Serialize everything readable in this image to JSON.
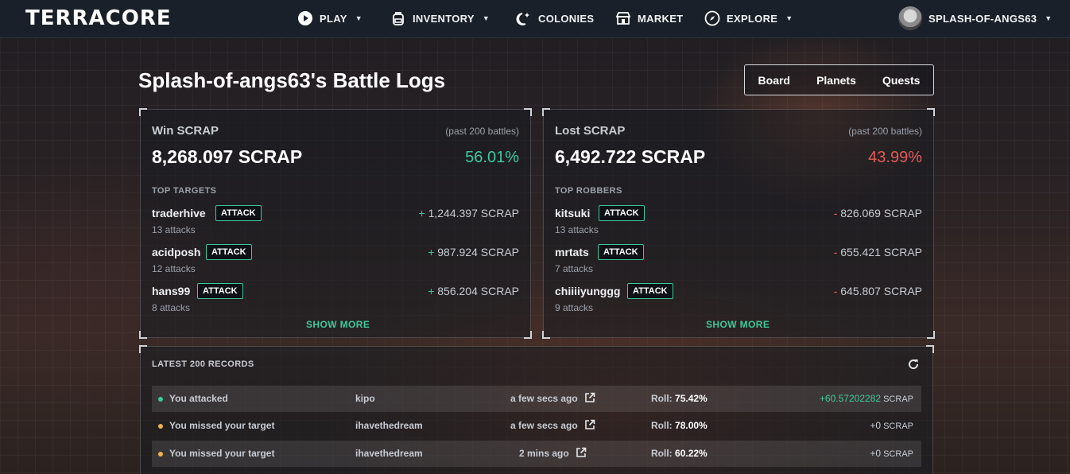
{
  "nav": {
    "logo": "TERRACORE",
    "items": [
      {
        "label": "PLAY",
        "icon": "play-icon",
        "caret": true
      },
      {
        "label": "INVENTORY",
        "icon": "backpack-icon",
        "caret": true
      },
      {
        "label": "COLONIES",
        "icon": "moon-stars-icon",
        "caret": false
      },
      {
        "label": "MARKET",
        "icon": "store-icon",
        "caret": false
      },
      {
        "label": "EXPLORE",
        "icon": "compass-icon",
        "caret": true
      }
    ],
    "user": "SPLASH-OF-ANGS63"
  },
  "page": {
    "title": "Splash-of-angs63's Battle Logs",
    "tabs": [
      "Board",
      "Planets",
      "Quests"
    ]
  },
  "win": {
    "title": "Win SCRAP",
    "sub": "(past 200 battles)",
    "amount": "8,268.097 SCRAP",
    "pct": "56.01%",
    "section": "TOP TARGETS",
    "rows": [
      {
        "name": "traderhive",
        "attacks": "13 attacks",
        "sign": "+",
        "amount": "1,244.397 SCRAP"
      },
      {
        "name": "acidposh",
        "attacks": "12 attacks",
        "sign": "+",
        "amount": "987.924 SCRAP"
      },
      {
        "name": "hans99",
        "attacks": "8 attacks",
        "sign": "+",
        "amount": "856.204 SCRAP"
      }
    ],
    "show_more": "SHOW MORE"
  },
  "lost": {
    "title": "Lost SCRAP",
    "sub": "(past 200 battles)",
    "amount": "6,492.722 SCRAP",
    "pct": "43.99%",
    "section": "TOP ROBBERS",
    "rows": [
      {
        "name": "kitsuki",
        "attacks": "13 attacks",
        "sign": "-",
        "amount": "826.069 SCRAP"
      },
      {
        "name": "mrtats",
        "attacks": "7 attacks",
        "sign": "-",
        "amount": "655.421 SCRAP"
      },
      {
        "name": "chiiiiyunggg",
        "attacks": "9 attacks",
        "sign": "-",
        "amount": "645.807 SCRAP"
      }
    ],
    "show_more": "SHOW MORE"
  },
  "attack_label": "ATTACK",
  "records": {
    "title": "LATEST 200 RECORDS",
    "roll_label": "Roll:",
    "rows": [
      {
        "status": "win",
        "message": "You attacked",
        "target": "kipo",
        "time": "a few secs ago",
        "roll": "75.42%",
        "amount": "+60.57202282",
        "unit": "SCRAP"
      },
      {
        "status": "miss",
        "message": "You missed your target",
        "target": "ihavethedream",
        "time": "a few secs ago",
        "roll": "78.00%",
        "amount": "+0",
        "unit": "SCRAP"
      },
      {
        "status": "miss",
        "message": "You missed your target",
        "target": "ihavethedream",
        "time": "2 mins ago",
        "roll": "60.22%",
        "amount": "+0",
        "unit": "SCRAP"
      }
    ]
  },
  "colors": {
    "accent_green": "#3ec99a",
    "loss_red": "#e25a5a",
    "miss_yellow": "#f0b24a",
    "nav_bg": "#1a2029"
  }
}
